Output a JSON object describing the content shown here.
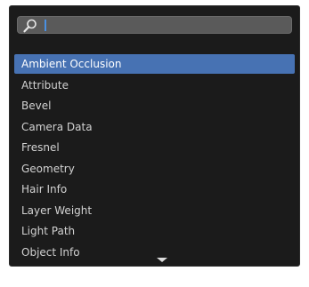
{
  "search": {
    "value": "",
    "placeholder": "",
    "icon": "search-icon"
  },
  "list": {
    "items": [
      {
        "label": "Ambient Occlusion",
        "selected": true
      },
      {
        "label": "Attribute",
        "selected": false
      },
      {
        "label": "Bevel",
        "selected": false
      },
      {
        "label": "Camera Data",
        "selected": false
      },
      {
        "label": "Fresnel",
        "selected": false
      },
      {
        "label": "Geometry",
        "selected": false
      },
      {
        "label": "Hair Info",
        "selected": false
      },
      {
        "label": "Layer Weight",
        "selected": false
      },
      {
        "label": "Light Path",
        "selected": false
      },
      {
        "label": "Object Info",
        "selected": false
      }
    ]
  },
  "scroll_indicator": "chevron-down-icon",
  "colors": {
    "panel_bg": "#1b1b1b",
    "search_bg": "#5a5a5a",
    "selection": "#4772b3",
    "caret": "#4a90e2",
    "text": "#d2d2d2"
  }
}
